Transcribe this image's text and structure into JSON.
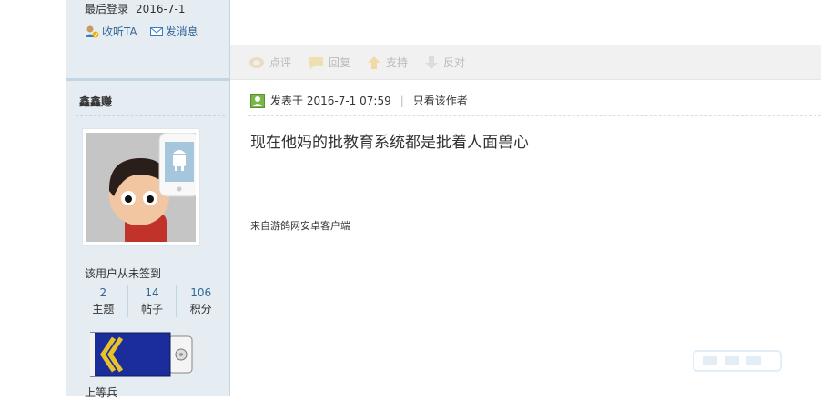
{
  "sidebar": {
    "last_login_label": "最后登录",
    "last_login_date": "2016-7-1",
    "follow_label": "收听TA",
    "message_label": "发消息",
    "username": "鑫鑫赚",
    "signin_status": "该用户从未签到",
    "stats": [
      {
        "value": "2",
        "label": "主题"
      },
      {
        "value": "14",
        "label": "帖子"
      },
      {
        "value": "106",
        "label": "积分"
      }
    ],
    "rank_name": "上等兵"
  },
  "toolbar": {
    "items": [
      {
        "label": "点评",
        "icon": "comment-icon"
      },
      {
        "label": "回复",
        "icon": "reply-icon"
      },
      {
        "label": "支持",
        "icon": "thumb-up-icon"
      },
      {
        "label": "反对",
        "icon": "thumb-down-icon"
      }
    ]
  },
  "post": {
    "posted_prefix": "发表于",
    "posted_time": "2016-7-1 07:59",
    "only_author_label": "只看该作者",
    "content": "现在他妈的批教育系统都是批着人面兽心",
    "source": "来自游鸽网安卓客户端"
  },
  "colors": {
    "sidebar_bg": "#e5edf2",
    "sidebar_border": "#c2d5e3",
    "link": "#336699",
    "toolbar_bg": "#f1f1f1",
    "badge_blue": "#1a2d9a",
    "badge_gold": "#e8c22a"
  }
}
